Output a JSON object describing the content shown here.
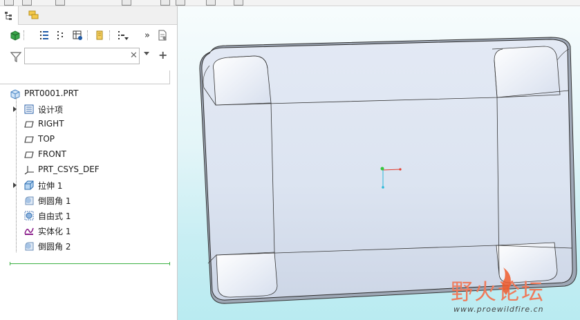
{
  "tree": {
    "root": "PRT0001.PRT",
    "items": [
      {
        "label": "设计项",
        "icon": "design-items-icon",
        "expandable": true
      },
      {
        "label": "RIGHT",
        "icon": "datum-plane-icon",
        "expandable": false
      },
      {
        "label": "TOP",
        "icon": "datum-plane-icon",
        "expandable": false
      },
      {
        "label": "FRONT",
        "icon": "datum-plane-icon",
        "expandable": false
      },
      {
        "label": "PRT_CSYS_DEF",
        "icon": "csys-icon",
        "expandable": false
      },
      {
        "label": "拉伸 1",
        "icon": "extrude-icon",
        "expandable": true
      },
      {
        "label": "倒圆角 1",
        "icon": "round-icon",
        "expandable": false
      },
      {
        "label": "自由式 1",
        "icon": "freestyle-icon",
        "expandable": false
      },
      {
        "label": "实体化 1",
        "icon": "solidify-icon",
        "expandable": false
      },
      {
        "label": "倒圆角 2",
        "icon": "round-icon",
        "expandable": false
      }
    ]
  },
  "filter": {
    "value": ""
  },
  "toolbar": {
    "more_label": "»"
  },
  "watermark": {
    "title": "野火论坛",
    "url": "www.proewildfire.cn"
  },
  "colors": {
    "accent_green": "#3cb043",
    "viewport_top": "#f7fcfd",
    "viewport_bottom": "#b9ebf1",
    "model_face": "#dfe7f3"
  }
}
